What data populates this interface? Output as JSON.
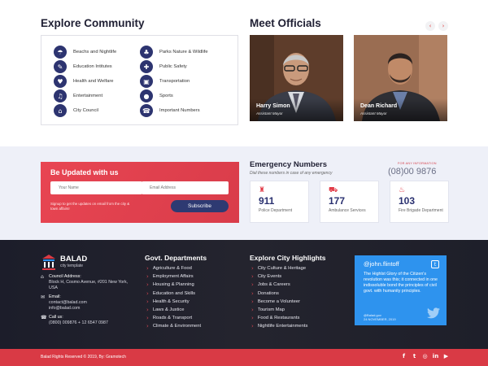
{
  "explore": {
    "title": "Explore Community",
    "categories": [
      {
        "label": "Beachs and Nightlife",
        "icon": "beach-icon",
        "glyph": "☂"
      },
      {
        "label": "Education Intitutes",
        "icon": "education-icon",
        "glyph": "✎"
      },
      {
        "label": "Health and Welfare",
        "icon": "health-icon",
        "glyph": "♥"
      },
      {
        "label": "Entertainment",
        "icon": "entertainment-icon",
        "glyph": "♫"
      },
      {
        "label": "City Council",
        "icon": "council-icon",
        "glyph": "⌂"
      },
      {
        "label": "Parks Nature & Wildlife",
        "icon": "park-icon",
        "glyph": "♣"
      },
      {
        "label": "Public Safety",
        "icon": "shield-icon",
        "glyph": "✚"
      },
      {
        "label": "Transportation",
        "icon": "bus-icon",
        "glyph": "▣"
      },
      {
        "label": "Sports",
        "icon": "sports-icon",
        "glyph": "●"
      },
      {
        "label": "Important Numbers",
        "icon": "phone-icon",
        "glyph": "☎"
      }
    ]
  },
  "officials": {
    "title": "Meet Officials",
    "prev_glyph": "‹",
    "next_glyph": "›",
    "people": [
      {
        "name": "Harry Simon",
        "role": "Assistant Mayor"
      },
      {
        "name": "Dean Richard",
        "role": "Assistant Mayor"
      }
    ]
  },
  "updates": {
    "title": "Be Updated with us",
    "name_placeholder": "Your Name",
    "email_placeholder": "Email Address",
    "note": "Signup to get the updates on email from the city & town affairs!",
    "button": "Subscribe"
  },
  "emergency": {
    "title": "Emergency Numbers",
    "subtitle": "Dial these numbers in case of any emergency",
    "info_label": "For any information",
    "info_number": "(08)00 9876",
    "cards": [
      {
        "number": "911",
        "label": "Police Department",
        "icon": "police-icon",
        "glyph": "♜"
      },
      {
        "number": "177",
        "label": "Ambulance Services",
        "icon": "ambulance-icon",
        "glyph": "⛟"
      },
      {
        "number": "103",
        "label": "Fire Brigade Department",
        "icon": "fire-extinguisher-icon",
        "glyph": "♨"
      }
    ]
  },
  "footer": {
    "logo_name": "BALAD",
    "logo_tag": "city template",
    "contacts": [
      {
        "icon": "location-icon",
        "glyph": "⌂",
        "label": "Council Address:",
        "text": "Block H, Cosmo Avenue, #201 New York, USA"
      },
      {
        "icon": "email-icon",
        "glyph": "✉",
        "label": "Email:",
        "text": "contact@balad.com info@balad.com"
      },
      {
        "icon": "phone-icon",
        "glyph": "☎",
        "label": "Call us:",
        "text": "(0800) 009876 + 12 6547 0987"
      }
    ],
    "govt": {
      "title": "Govt. Departments",
      "items": [
        "Agriculture & Food",
        "Employment Affairs",
        "Housing & Planning",
        "Education and Skills",
        "Health & Security",
        "Laws & Justice",
        "Roads & Transport",
        "Climate & Environment"
      ]
    },
    "highlights": {
      "title": "Explore City Highlights",
      "items": [
        "City Culture & Heritage",
        "City Events",
        "Jobs & Careers",
        "Donations",
        "Become a Volunteer",
        "Tourism Map",
        "Food & Restaurants",
        "Nightlife Entertainments"
      ]
    },
    "tweet": {
      "handle": "@john.flintoff",
      "text": "The Highlst Glory of the Citizen's revolution was this; it connected in one indissoluble bond the principles of civil govt. with humanity principles.",
      "meta_line1": "@Balad.gov",
      "meta_line2": "24 NOVEMBER, 2019"
    },
    "copyright": "Balad Rights Reserved © 2019, By: Gramotech",
    "social": [
      "f",
      "t",
      "◎",
      "in",
      "▶"
    ]
  },
  "colors": {
    "navy": "#2d3470",
    "red": "#d93a45",
    "twitter": "#2e93ee",
    "footer_bg": "#1e1f2a"
  }
}
